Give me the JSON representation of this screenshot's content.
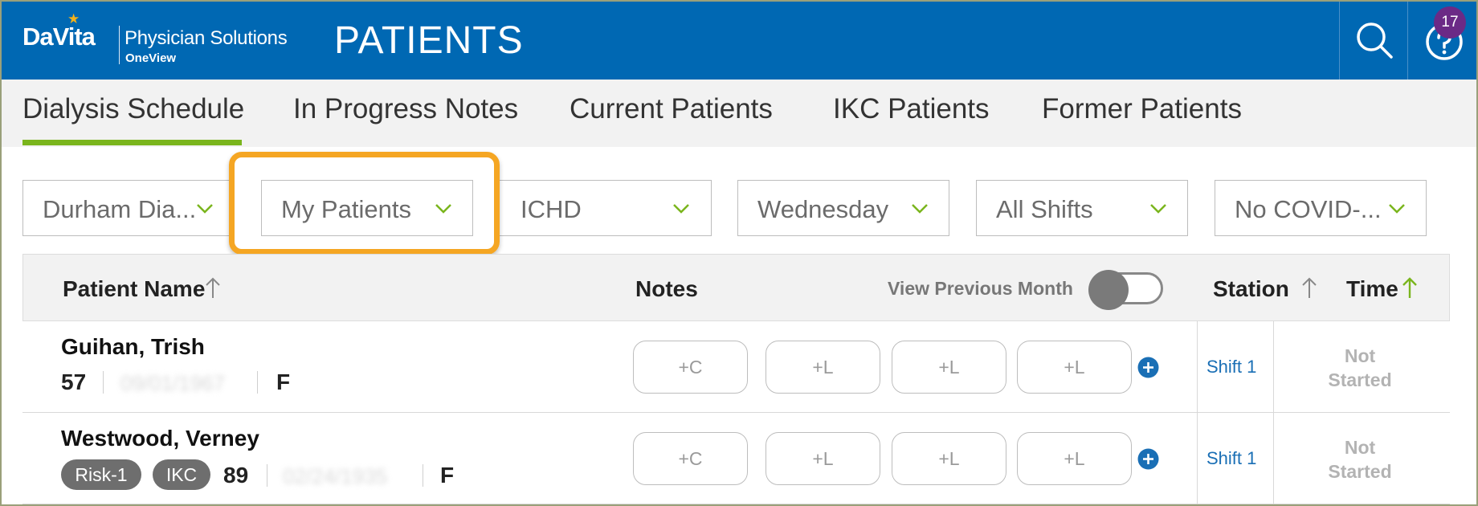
{
  "app": {
    "brand": "DaVita",
    "product": "Physician Solutions",
    "product_sub": "OneView",
    "page_title": "PATIENTS",
    "notification_count": "17"
  },
  "tabs": [
    {
      "label": "Dialysis Schedule",
      "active": true
    },
    {
      "label": "In Progress Notes",
      "active": false
    },
    {
      "label": "Current Patients",
      "active": false
    },
    {
      "label": "IKC Patients",
      "active": false
    },
    {
      "label": "Former Patients",
      "active": false
    }
  ],
  "filters": [
    {
      "value": "Durham Dia..."
    },
    {
      "value": "My Patients",
      "highlighted": true
    },
    {
      "value": "ICHD"
    },
    {
      "value": "Wednesday"
    },
    {
      "value": "All Shifts"
    },
    {
      "value": "No COVID-..."
    }
  ],
  "table": {
    "columns": {
      "patient_name": "Patient Name",
      "notes": "Notes",
      "view_previous_month": "View Previous Month",
      "station": "Station",
      "time": "Time"
    },
    "rows": [
      {
        "name": "Guihan, Trish",
        "tags": [],
        "age": "57",
        "dob": "09/01/1967",
        "sex": "F",
        "notes": [
          "+C",
          "+L",
          "+L",
          "+L"
        ],
        "station": "Shift 1",
        "status_line1": "Not",
        "status_line2": "Started"
      },
      {
        "name": "Westwood, Verney",
        "tags": [
          "Risk-1",
          "IKC"
        ],
        "age": "89",
        "dob": "02/24/1935",
        "sex": "F",
        "notes": [
          "+C",
          "+L",
          "+L",
          "+L"
        ],
        "station": "Shift 1",
        "status_line1": "Not",
        "status_line2": "Started"
      }
    ]
  },
  "colors": {
    "header_blue": "#0068b3",
    "accent_green": "#7ab51d",
    "highlight_orange": "#f5a623",
    "badge_purple": "#6b2a86",
    "link_blue": "#1a6fb5"
  },
  "icons": {
    "search": "search-icon",
    "help": "help-icon",
    "dropdown": "chevron-down-icon",
    "sort": "arrow-up-icon",
    "add": "plus-circle-icon"
  }
}
